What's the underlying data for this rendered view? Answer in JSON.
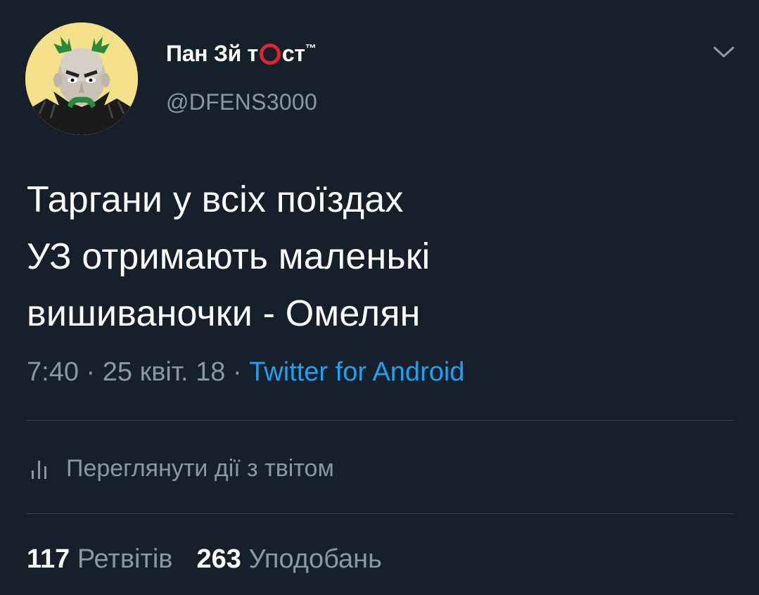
{
  "author": {
    "name_before": "Пан Зй т",
    "name_after": "ст",
    "name_trademark": "™",
    "handle": "@DFENS3000",
    "avatar_icon": "avatar-cartoon-face-icon",
    "name_mark_color": "#e0242f"
  },
  "menu": {
    "icon": "chevron-down-icon"
  },
  "tweet": {
    "lines": [
      "Таргани у всіх поїздах",
      "УЗ отримають маленькі",
      "вишиваночки - Омелян"
    ],
    "time": "7:40",
    "sep1": " · ",
    "date": "25 квіт. 18",
    "sep2": " · ",
    "source": "Twitter for Android"
  },
  "activity": {
    "icon": "bar-chart-icon",
    "label": "Переглянути дії з твітом"
  },
  "stats": {
    "retweets_count": "117",
    "retweets_label": " Ретвітів",
    "likes_count": "263",
    "likes_label": " Уподобань"
  },
  "colors": {
    "background": "#15202b",
    "text_primary": "#ffffff",
    "text_secondary": "#8899a6",
    "link": "#1da1f2",
    "divider": "#38444d"
  }
}
